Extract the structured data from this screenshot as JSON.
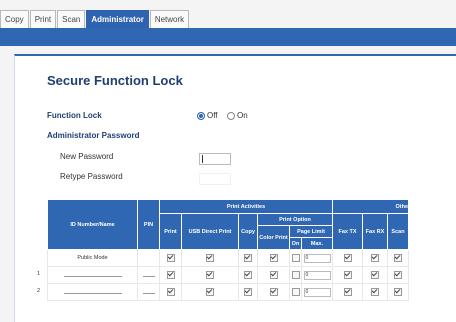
{
  "tabs": [
    {
      "label": "Copy",
      "active": false
    },
    {
      "label": "Print",
      "active": false
    },
    {
      "label": "Scan",
      "active": false
    },
    {
      "label": "Administrator",
      "active": true
    },
    {
      "label": "Network",
      "active": false
    }
  ],
  "page": {
    "title": "Secure Function Lock",
    "function_lock_label": "Function Lock",
    "function_lock_value": "Off",
    "radio_off_label": "Off",
    "radio_on_label": "On",
    "admin_password_label": "Administrator Password",
    "new_password_label": "New Password",
    "retype_password_label": "Retype Password"
  },
  "table": {
    "header_id": "ID Number/Name",
    "header_pin": "PIN",
    "header_print_activities": "Print Activities",
    "header_others": "Othe",
    "header_print": "Print",
    "header_usb": "USB Direct Print",
    "header_copy": "Copy",
    "header_print_option": "Print Option",
    "header_color_print": "Color Print",
    "header_page_limit": "Page Limit",
    "header_on": "On",
    "header_max": "Max.",
    "header_fax_tx": "Fax TX",
    "header_fax_rx": "Fax RX",
    "header_scan": "Scan",
    "rows": [
      {
        "num": "",
        "id": "Public Mode",
        "print": true,
        "usb": true,
        "copy": true,
        "color": true,
        "on": false,
        "max": "0",
        "fax_tx": true,
        "fax_rx": true,
        "scan": true
      },
      {
        "num": "1",
        "id": "",
        "print": true,
        "usb": true,
        "copy": true,
        "color": true,
        "on": false,
        "max": "0",
        "fax_tx": true,
        "fax_rx": true,
        "scan": true
      },
      {
        "num": "2",
        "id": "",
        "print": true,
        "usb": true,
        "copy": true,
        "color": true,
        "on": false,
        "max": "0",
        "fax_tx": true,
        "fax_rx": true,
        "scan": true
      }
    ]
  }
}
